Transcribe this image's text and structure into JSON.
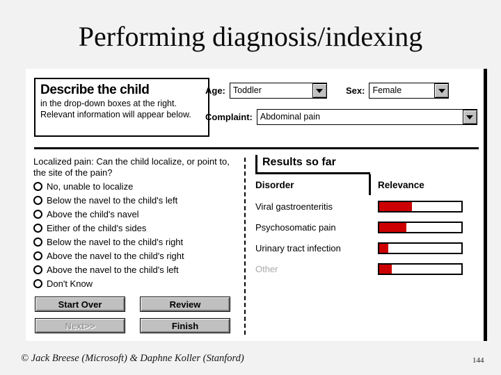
{
  "slide": {
    "title": "Performing diagnosis/indexing",
    "page_number": "144",
    "credit": "© Jack Breese (Microsoft) & Daphne Koller (Stanford)"
  },
  "app": {
    "describe_panel": {
      "heading": "Describe the child",
      "body": "in the drop-down boxes at the right. Relevant information will appear below."
    },
    "fields": {
      "age": {
        "label": "Age:",
        "value": "Toddler"
      },
      "sex": {
        "label": "Sex:",
        "value": "Female"
      },
      "complaint": {
        "label": "Complaint:",
        "value": "Abdominal pain"
      }
    },
    "question": {
      "prompt": "Localized pain:  Can the child localize, or point to, the site of the pain?",
      "options": [
        {
          "label": "No, unable to localize",
          "selected": false
        },
        {
          "label": "Below the navel to the child's left",
          "selected": false
        },
        {
          "label": "Above the child's navel",
          "selected": false
        },
        {
          "label": "Either of the child's sides",
          "selected": false
        },
        {
          "label": "Below the navel to the child's right",
          "selected": false
        },
        {
          "label": "Above the navel to the child's right",
          "selected": false
        },
        {
          "label": "Above the navel to the child's left",
          "selected": false
        },
        {
          "label": "Don't Know",
          "selected": false
        }
      ]
    },
    "buttons": [
      {
        "label": "Start Over",
        "disabled": false
      },
      {
        "label": "Review",
        "disabled": false
      },
      {
        "label": "Next>>",
        "disabled": true
      },
      {
        "label": "Finish",
        "disabled": false
      }
    ],
    "results": {
      "title": "Results so far",
      "columns": {
        "disorder": "Disorder",
        "relevance": "Relevance"
      },
      "accent_color": "#cc0000",
      "rows": [
        {
          "disorder": "Viral gastroenteritis",
          "relevance_pct": 40,
          "muted": false
        },
        {
          "disorder": "Psychosomatic pain",
          "relevance_pct": 33,
          "muted": false
        },
        {
          "disorder": "Urinary tract infection",
          "relevance_pct": 11,
          "muted": false
        },
        {
          "disorder": "Other",
          "relevance_pct": 15,
          "muted": true
        }
      ]
    }
  }
}
